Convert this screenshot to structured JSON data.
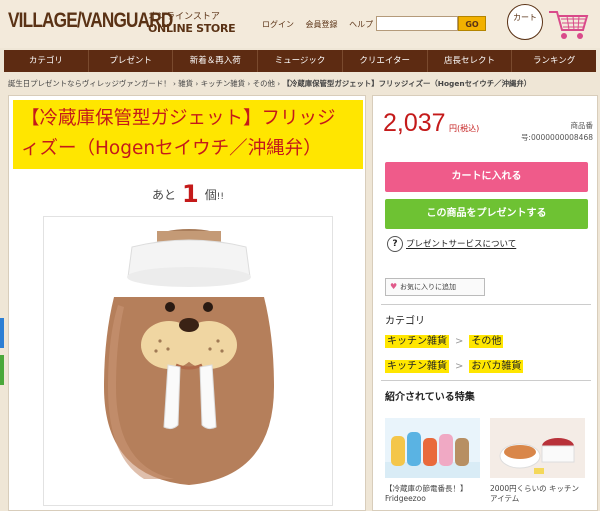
{
  "header": {
    "logo_text": "VILLAGE/VANGUARD",
    "logo_sub_ja": "オンラインストア",
    "logo_sub_en": "ONLINE STORE",
    "links": [
      "ログイン",
      "会員登録",
      "ヘルプ"
    ],
    "search_placeholder": "",
    "search_button": "GO",
    "cart_bubble": "カート",
    "colors": {
      "brand_brown": "#5d2b12",
      "accent_yellow": "#ffe600",
      "price_red": "#c41a1a"
    }
  },
  "nav": {
    "items": [
      "カテゴリ",
      "プレゼント",
      "新着＆再入荷",
      "ミュージック",
      "クリエイター",
      "店長セレクト",
      "ランキング"
    ]
  },
  "breadcrumb": {
    "items": [
      "誕生日プレゼントならヴィレッジヴァンガード！",
      "雑貨",
      "キッチン雑貨",
      "その他"
    ],
    "current": "【冷蔵庫保管型ガジェット】フリッジィズー（Hogenセイウチ／沖縄弁）"
  },
  "product": {
    "title_line1": "【冷蔵庫保管型ガジェット】フリッジ",
    "title_line2": "ィズー（Hogenセイウチ／沖縄弁）",
    "stock_prefix": "あと",
    "stock_count": "1",
    "stock_suffix": "個",
    "stock_mark": "!!",
    "image_icon": "walrus-fridge-figure-image"
  },
  "purchase": {
    "price": "2,037",
    "price_unit": "円(税込)",
    "product_no_label": "商品番",
    "product_no": "号:0000000008468",
    "cart_button": "カートに入れる",
    "present_button": "この商品をプレゼントする",
    "present_service_link": "プレゼントサービスについて",
    "favorite_button": "お気に入りに追加"
  },
  "category": {
    "label": "カテゴリ",
    "rows": [
      {
        "parent": "キッチン雑貨",
        "child": "その他"
      },
      {
        "parent": "キッチン雑貨",
        "child": "おバカ雑貨"
      }
    ]
  },
  "features": {
    "label": "紹介されている特集",
    "cards": [
      {
        "title": "【冷蔵庫の節電番長！】Fridgeezoo"
      },
      {
        "title": "2000円くらいの キッチンアイテム"
      }
    ]
  }
}
